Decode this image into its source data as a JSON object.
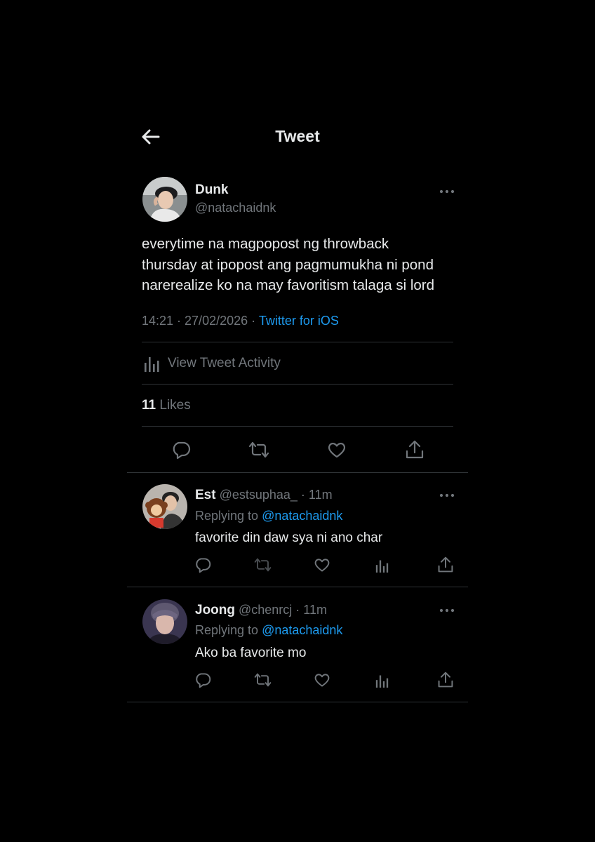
{
  "header": {
    "title": "Tweet",
    "back_icon": "arrow-left-icon"
  },
  "tweet": {
    "author": {
      "name": "Dunk",
      "handle": "@natachaidnk"
    },
    "text_lines": [
      "everytime na magpopost ng throwback",
      "thursday at ipopost ang pagmumukha ni pond",
      "narerealize ko na may favoritism talaga si lord"
    ],
    "time_date": "14:21 · 27/02/2026 · ",
    "source": "Twitter for iOS",
    "activity_label": "View Tweet Activity",
    "likes_count": "11",
    "likes_label": " Likes",
    "actions": [
      "reply-icon",
      "retweet-icon",
      "like-icon",
      "share-icon"
    ]
  },
  "replies": [
    {
      "name": "Est",
      "handle_time": " @estsuphaa_ · 11m",
      "replying_prefix": "Replying to ",
      "replying_to": "@natachaidnk",
      "text": "favorite din daw sya ni ano char"
    },
    {
      "name": "Joong",
      "handle_time": " @chenrcj · 11m",
      "replying_prefix": "Replying to ",
      "replying_to": "@natachaidnk",
      "text": "Ako ba favorite mo"
    }
  ],
  "colors": {
    "background": "#000000",
    "text": "#e7e9ea",
    "muted": "#71767b",
    "accent": "#1d9bf0",
    "divider": "#2f3336"
  }
}
